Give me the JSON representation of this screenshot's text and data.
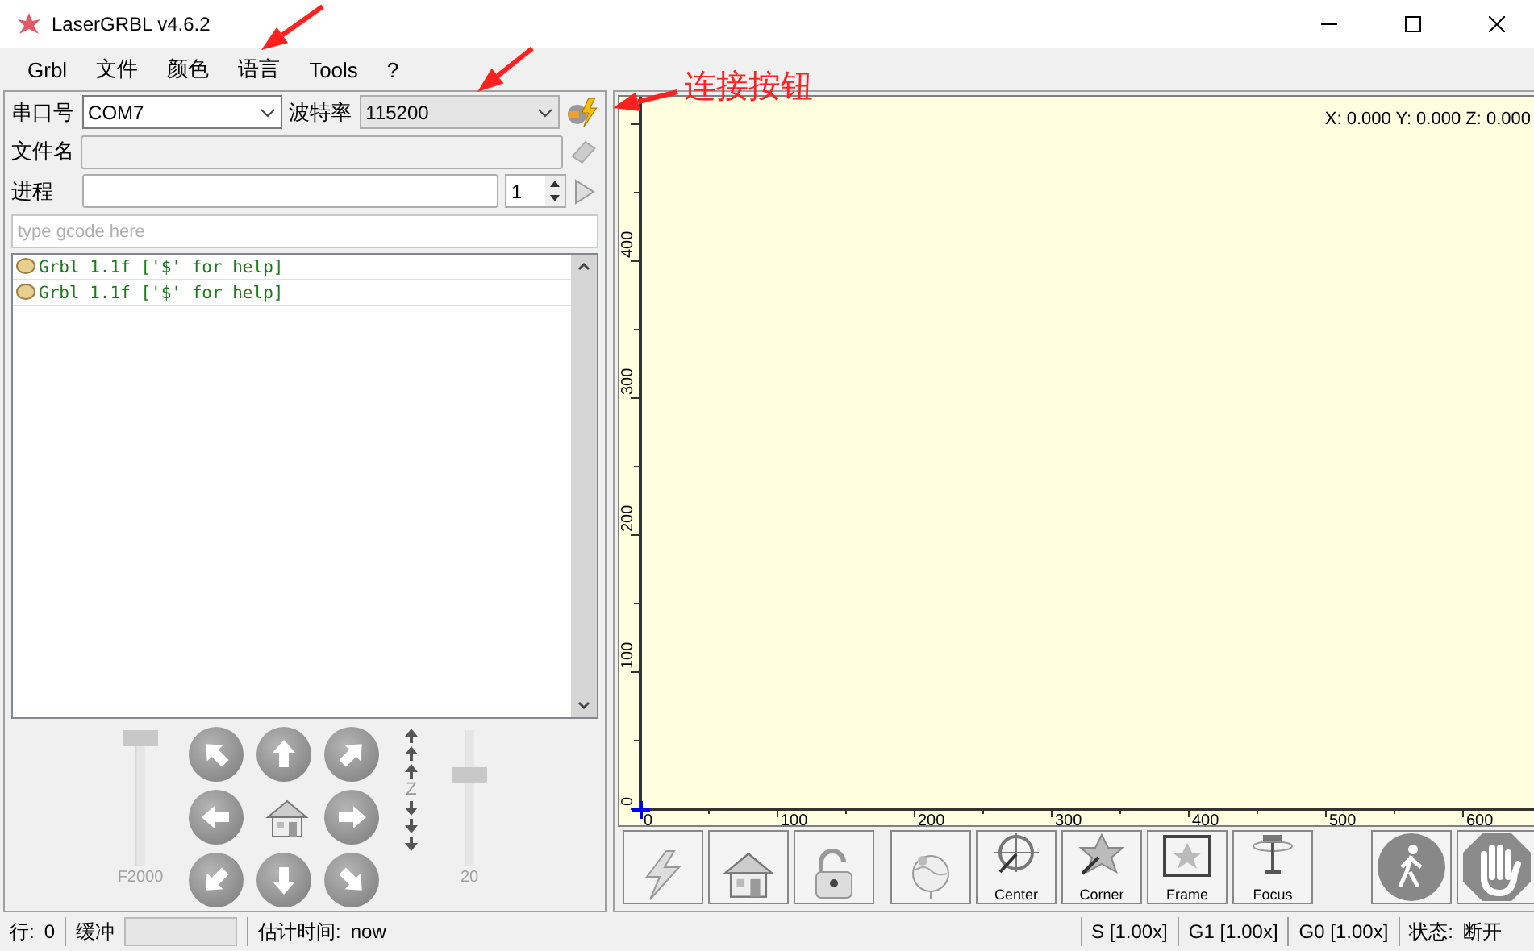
{
  "window": {
    "title": "LaserGRBL v4.6.2"
  },
  "menu": [
    "Grbl",
    "文件",
    "颜色",
    "语言",
    "Tools",
    "?"
  ],
  "connection": {
    "port_label": "串口号",
    "port": "COM7",
    "baud_label": "波特率",
    "baud": "115200"
  },
  "file": {
    "label": "文件名"
  },
  "progress": {
    "label": "进程",
    "copies": "1",
    "level": 0
  },
  "gcode": {
    "placeholder": "type gcode here"
  },
  "log": [
    "Grbl 1.1f ['$' for help]",
    "Grbl 1.1f ['$' for help]"
  ],
  "jog": {
    "speed": {
      "label": "F2000",
      "level": 1
    },
    "step": {
      "label": "20",
      "level": 0.69
    },
    "z_label": "Z"
  },
  "canvas": {
    "position": "X: 0.000 Y: 0.000 Z: 0.000",
    "x_ruler": [
      "0",
      "100",
      "200",
      "300",
      "400",
      "500",
      "600"
    ],
    "y_ruler": [
      "0",
      "100",
      "200",
      "300",
      "400"
    ]
  },
  "toolbar": [
    {
      "kind": "connect"
    },
    {
      "kind": "home"
    },
    {
      "kind": "unlock"
    },
    {
      "kind": "globe"
    },
    {
      "kind": "center",
      "label": "Center"
    },
    {
      "kind": "corner",
      "label": "Corner"
    },
    {
      "kind": "frame",
      "label": "Frame"
    },
    {
      "kind": "focus",
      "label": "Focus"
    },
    {
      "kind": "walk"
    },
    {
      "kind": "stop"
    }
  ],
  "annotation": {
    "label": "连接按钮"
  },
  "status_bar": {
    "line_label": "行:",
    "line": "0",
    "buffer_label": "缓冲",
    "eta_label": "估计时间:",
    "eta": "now",
    "overrides": [
      "S [1.00x]",
      "G1 [1.00x]",
      "G0 [1.00x]"
    ],
    "state_label": "状态:",
    "state": "断开"
  }
}
